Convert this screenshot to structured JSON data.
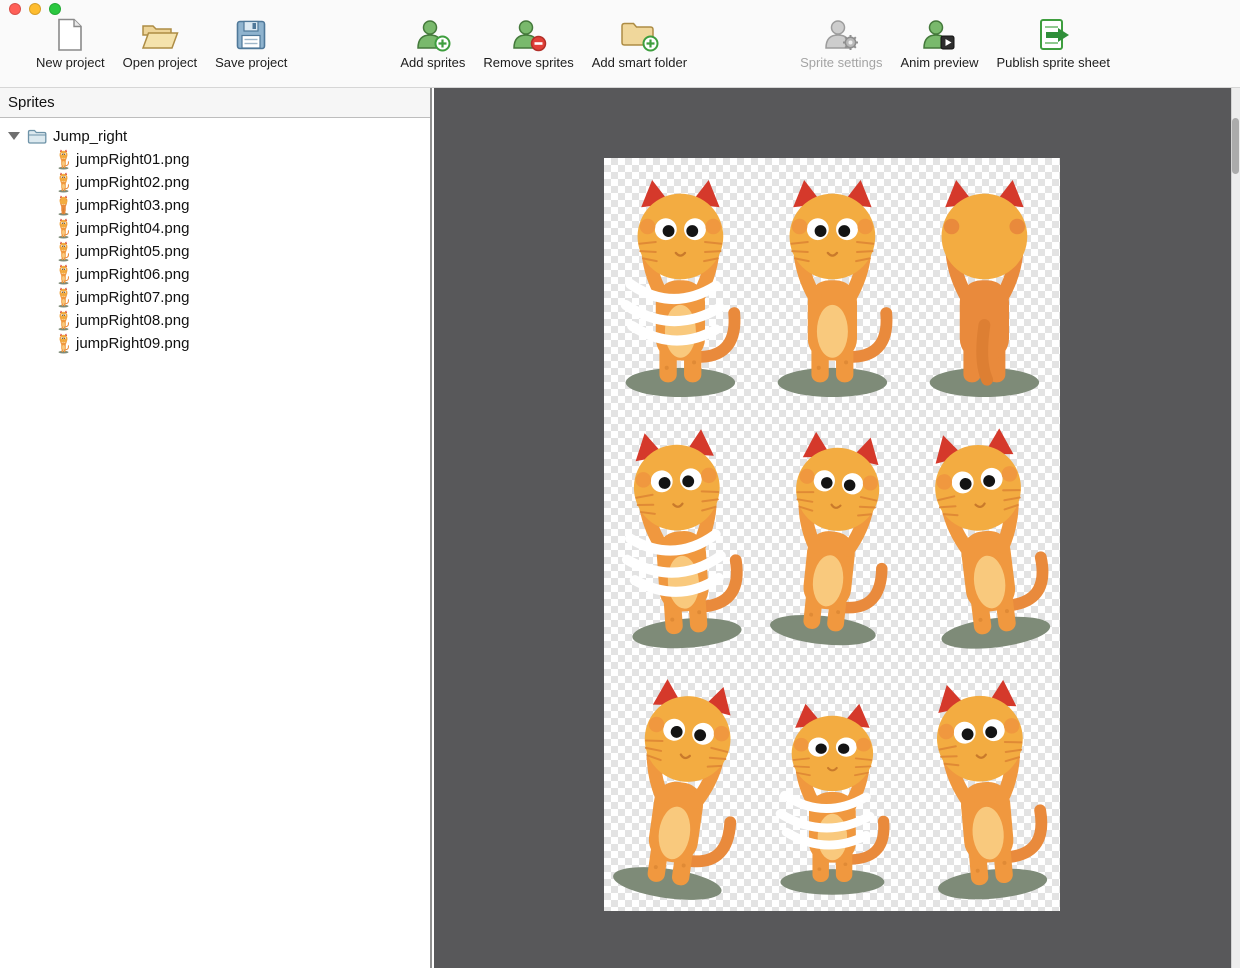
{
  "window": {
    "controls": [
      "close",
      "minimize",
      "zoom"
    ],
    "control_colors": {
      "close": "#FF5F57",
      "minimize": "#FEBC2E",
      "zoom": "#2BC840"
    }
  },
  "toolbar": {
    "items": [
      {
        "id": "new-project",
        "label": "New project",
        "icon": "blank-page",
        "enabled": true
      },
      {
        "id": "open-project",
        "label": "Open project",
        "icon": "open-folder",
        "enabled": true
      },
      {
        "id": "save-project",
        "label": "Save project",
        "icon": "floppy-disk",
        "enabled": true
      },
      {
        "id": "add-sprites",
        "label": "Add sprites",
        "icon": "person-plus",
        "enabled": true
      },
      {
        "id": "remove-sprites",
        "label": "Remove sprites",
        "icon": "person-minus",
        "enabled": true
      },
      {
        "id": "add-smart-folder",
        "label": "Add smart folder",
        "icon": "folder-plus",
        "enabled": true
      },
      {
        "id": "sprite-settings",
        "label": "Sprite settings",
        "icon": "person-gear",
        "enabled": false
      },
      {
        "id": "anim-preview",
        "label": "Anim preview",
        "icon": "person-play",
        "enabled": true
      },
      {
        "id": "publish-sprite-sheet",
        "label": "Publish sprite sheet",
        "icon": "sheet-arrow",
        "enabled": true
      }
    ]
  },
  "sidebar": {
    "title": "Sprites",
    "folder": {
      "name": "Jump_right",
      "expanded": true
    },
    "files": [
      "jumpRight01.png",
      "jumpRight02.png",
      "jumpRight03.png",
      "jumpRight04.png",
      "jumpRight05.png",
      "jumpRight06.png",
      "jumpRight07.png",
      "jumpRight08.png",
      "jumpRight09.png"
    ]
  },
  "canvas": {
    "description": "sprite sheet preview of 9 cat jump-right animation frames on transparency checkerboard",
    "grid": {
      "rows": 3,
      "cols": 3
    },
    "frames": [
      {
        "pose": "arms-up-front",
        "swoosh": true
      },
      {
        "pose": "arms-up-front",
        "swoosh": false
      },
      {
        "pose": "back-view",
        "swoosh": false
      },
      {
        "pose": "arms-up-front",
        "swoosh": true
      },
      {
        "pose": "side-view",
        "swoosh": false
      },
      {
        "pose": "wave",
        "swoosh": false
      },
      {
        "pose": "arms-up-tilt",
        "swoosh": false
      },
      {
        "pose": "crouch",
        "swoosh": true
      },
      {
        "pose": "wave",
        "swoosh": false
      }
    ],
    "colors": {
      "canvas_bg": "#58585A",
      "cat_head": "#F3AC41",
      "cat_body": "#F0983F",
      "cat_belly": "#F9C97D",
      "ear_red": "#D5392B",
      "tail_orange": "#E98A3C",
      "shadow_green": "#7E8B78",
      "swoosh": "#FFFFFF"
    }
  }
}
